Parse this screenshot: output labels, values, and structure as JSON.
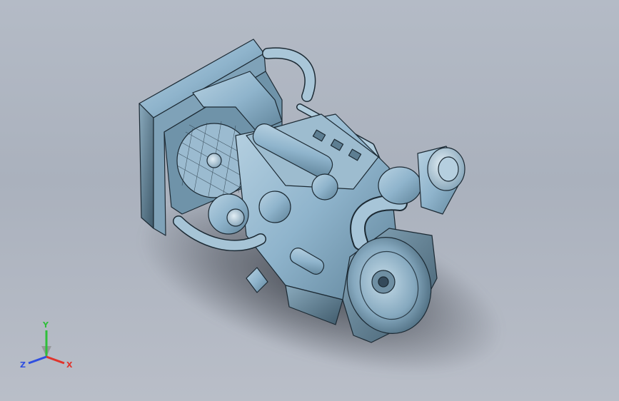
{
  "viewport": {
    "background_top": "#b4bbc6",
    "background_bottom": "#b9bec8",
    "model_color": "#8fb4cc",
    "model_edge_color": "#1c2a34"
  },
  "triad": {
    "x_label": "X",
    "y_label": "Y",
    "z_label": "Z",
    "x_color": "#e0342c",
    "y_color": "#2fbf3a",
    "z_color": "#2f4fe0"
  }
}
